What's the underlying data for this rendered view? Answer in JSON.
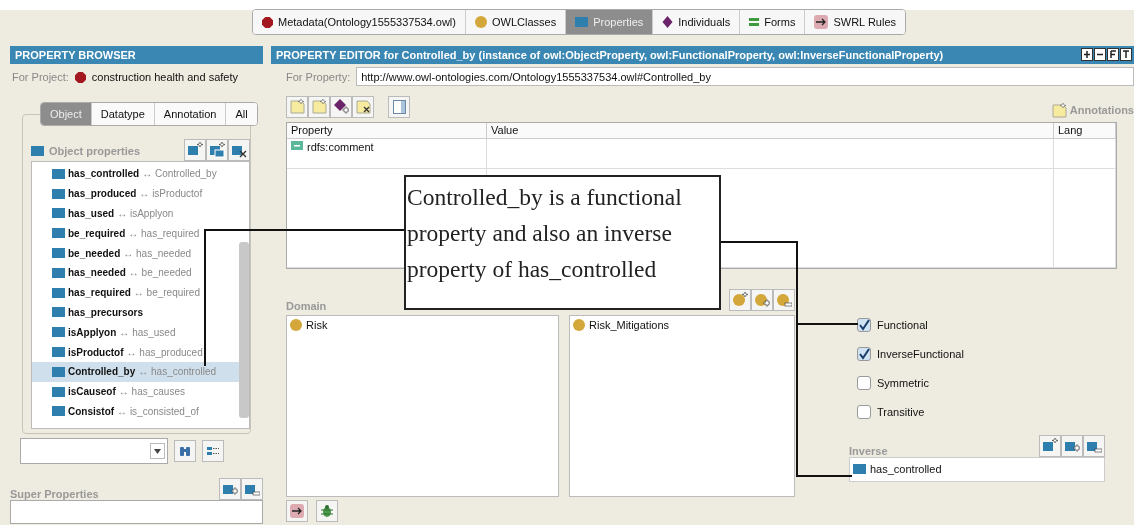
{
  "top_tabs": [
    {
      "label": "Metadata(Ontology1555337534.owl)",
      "selected": false
    },
    {
      "label": "OWLClasses",
      "selected": false
    },
    {
      "label": "Properties",
      "selected": true
    },
    {
      "label": "Individuals",
      "selected": false
    },
    {
      "label": "Forms",
      "selected": false
    },
    {
      "label": "SWRL Rules",
      "selected": false
    }
  ],
  "property_browser": {
    "title": "PROPERTY BROWSER",
    "project_label": "For Project:",
    "project": "construction health and safety",
    "tabs": [
      {
        "label": "Object",
        "selected": true
      },
      {
        "label": "Datatype",
        "selected": false
      },
      {
        "label": "Annotation",
        "selected": false
      },
      {
        "label": "All",
        "selected": false
      }
    ],
    "tree_root": "Object properties",
    "properties": [
      {
        "name": "has_controlled",
        "inverse": "Controlled_by",
        "selected": false
      },
      {
        "name": "has_produced",
        "inverse": "isProductof",
        "selected": false
      },
      {
        "name": "has_used",
        "inverse": "isApplyon",
        "selected": false
      },
      {
        "name": "be_required",
        "inverse": "has_required",
        "selected": false
      },
      {
        "name": "be_needed",
        "inverse": "has_needed",
        "selected": false
      },
      {
        "name": "has_needed",
        "inverse": "be_needed",
        "selected": false
      },
      {
        "name": "has_required",
        "inverse": "be_required",
        "selected": false
      },
      {
        "name": "has_precursors",
        "selected": false
      },
      {
        "name": "isApplyon",
        "inverse": "has_used",
        "selected": false
      },
      {
        "name": "isProductof",
        "inverse": "has_produced",
        "selected": false
      },
      {
        "name": "Controlled_by",
        "inverse": "has_controlled",
        "selected": true
      },
      {
        "name": "isCauseof",
        "inverse": "has_causes",
        "selected": false
      },
      {
        "name": "Consistof",
        "inverse": "is_consisted_of",
        "selected": false
      }
    ],
    "arrow": "↔",
    "super_properties_label": "Super Properties"
  },
  "property_editor": {
    "title": "PROPERTY EDITOR for Controlled_by   (instance of owl:ObjectProperty, owl:FunctionalProperty, owl:InverseFunctionalProperty)",
    "for_property_label": "For Property:",
    "uri": "http://www.owl-ontologies.com/Ontology1555337534.owl#Controlled_by",
    "annotations_label": "Annotations",
    "table": {
      "columns": [
        "Property",
        "Value",
        "Lang"
      ],
      "rows": [
        [
          "rdfs:comment",
          "",
          ""
        ]
      ]
    },
    "domain_label": "Domain",
    "domain": [
      "Risk"
    ],
    "range": [
      "Risk_Mitigations"
    ],
    "characteristics": [
      {
        "label": "Functional",
        "checked": true
      },
      {
        "label": "InverseFunctional",
        "checked": true
      },
      {
        "label": "Symmetric",
        "checked": false
      },
      {
        "label": "Transitive",
        "checked": false
      }
    ],
    "inverse_label": "Inverse",
    "inverse": [
      "has_controlled"
    ]
  },
  "callout": {
    "text": "Controlled_by is a functional property and also an inverse property of  has_controlled"
  }
}
